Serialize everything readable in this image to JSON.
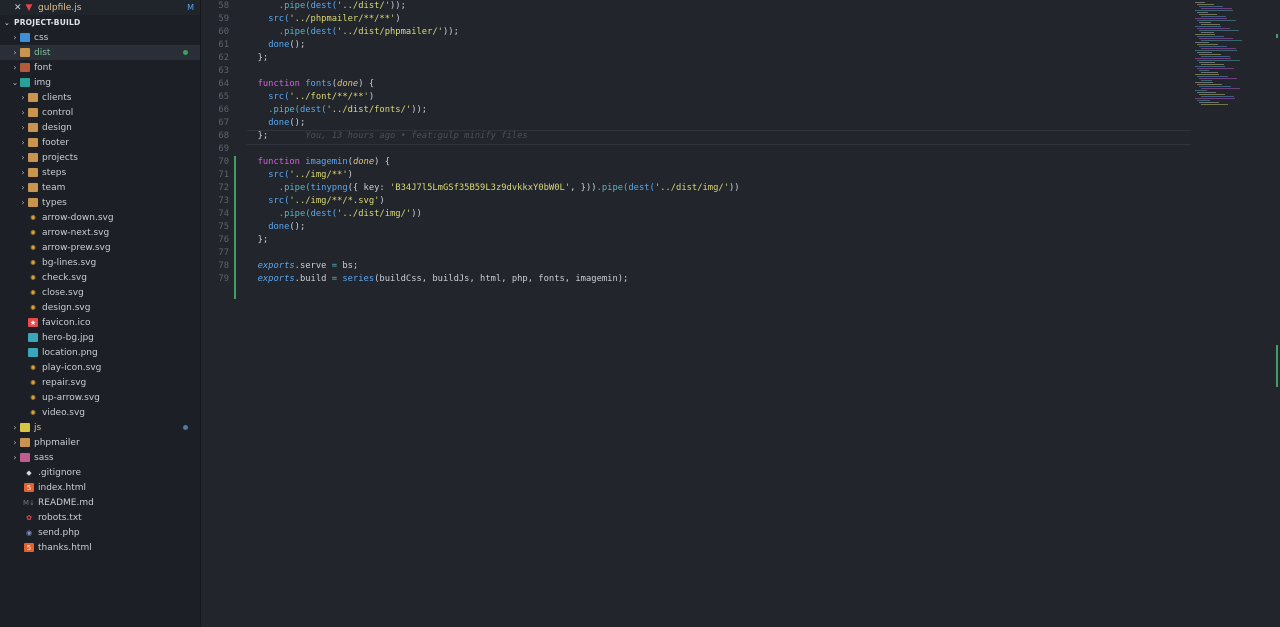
{
  "open_editor": {
    "close": "✕",
    "file": "gulpfile.js",
    "badge": "M"
  },
  "explorer": {
    "title": "PROJECT-BUILD",
    "items": [
      {
        "label": "css",
        "depth": 0,
        "type": "folder",
        "icon": "css-folder-icon",
        "open": false
      },
      {
        "label": "dist",
        "depth": 0,
        "type": "folder",
        "icon": "dist-folder-icon",
        "open": false,
        "selected": true,
        "dot": "#3f9e62"
      },
      {
        "label": "font",
        "depth": 0,
        "type": "folder",
        "icon": "font-folder-icon",
        "open": false
      },
      {
        "label": "img",
        "depth": 0,
        "type": "folder",
        "icon": "img-folder-icon",
        "open": true
      },
      {
        "label": "clients",
        "depth": 1,
        "type": "folder",
        "icon": "folder-icon",
        "open": false
      },
      {
        "label": "control",
        "depth": 1,
        "type": "folder",
        "icon": "folder-icon",
        "open": false
      },
      {
        "label": "design",
        "depth": 1,
        "type": "folder",
        "icon": "folder-icon",
        "open": false
      },
      {
        "label": "footer",
        "depth": 1,
        "type": "folder",
        "icon": "folder-icon",
        "open": false
      },
      {
        "label": "projects",
        "depth": 1,
        "type": "folder",
        "icon": "folder-icon",
        "open": false
      },
      {
        "label": "steps",
        "depth": 1,
        "type": "folder",
        "icon": "folder-icon",
        "open": false
      },
      {
        "label": "team",
        "depth": 1,
        "type": "folder",
        "icon": "folder-icon",
        "open": false
      },
      {
        "label": "types",
        "depth": 1,
        "type": "folder",
        "icon": "folder-icon",
        "open": false
      },
      {
        "label": "arrow-down.svg",
        "depth": 1,
        "type": "file",
        "icon": "svg-file-icon"
      },
      {
        "label": "arrow-next.svg",
        "depth": 1,
        "type": "file",
        "icon": "svg-file-icon"
      },
      {
        "label": "arrow-prew.svg",
        "depth": 1,
        "type": "file",
        "icon": "svg-file-icon"
      },
      {
        "label": "bg-lines.svg",
        "depth": 1,
        "type": "file",
        "icon": "svg-file-icon"
      },
      {
        "label": "check.svg",
        "depth": 1,
        "type": "file",
        "icon": "svg-file-icon"
      },
      {
        "label": "close.svg",
        "depth": 1,
        "type": "file",
        "icon": "svg-file-icon"
      },
      {
        "label": "design.svg",
        "depth": 1,
        "type": "file",
        "icon": "svg-file-icon"
      },
      {
        "label": "favicon.ico",
        "depth": 1,
        "type": "file",
        "icon": "favicon-file-icon"
      },
      {
        "label": "hero-bg.jpg",
        "depth": 1,
        "type": "file",
        "icon": "image-file-icon"
      },
      {
        "label": "location.png",
        "depth": 1,
        "type": "file",
        "icon": "image-file-icon"
      },
      {
        "label": "play-icon.svg",
        "depth": 1,
        "type": "file",
        "icon": "svg-file-icon"
      },
      {
        "label": "repair.svg",
        "depth": 1,
        "type": "file",
        "icon": "svg-file-icon"
      },
      {
        "label": "up-arrow.svg",
        "depth": 1,
        "type": "file",
        "icon": "svg-file-icon"
      },
      {
        "label": "video.svg",
        "depth": 1,
        "type": "file",
        "icon": "svg-file-icon"
      },
      {
        "label": "js",
        "depth": 0,
        "type": "folder",
        "icon": "js-folder-icon",
        "open": false,
        "dot": "#4d7a9e"
      },
      {
        "label": "phpmailer",
        "depth": 0,
        "type": "folder",
        "icon": "php-folder-icon",
        "open": false
      },
      {
        "label": "sass",
        "depth": 0,
        "type": "folder",
        "icon": "sass-folder-icon",
        "open": false
      },
      {
        "label": ".gitignore",
        "depth": 0,
        "type": "file",
        "icon": "git-file-icon"
      },
      {
        "label": "index.html",
        "depth": 0,
        "type": "file",
        "icon": "html-file-icon"
      },
      {
        "label": "README.md",
        "depth": 0,
        "type": "file",
        "icon": "markdown-file-icon"
      },
      {
        "label": "robots.txt",
        "depth": 0,
        "type": "file",
        "icon": "robot-file-icon"
      },
      {
        "label": "send.php",
        "depth": 0,
        "type": "file",
        "icon": "php-file-icon"
      },
      {
        "label": "thanks.html",
        "depth": 0,
        "type": "file",
        "icon": "html-file-icon"
      }
    ]
  },
  "code": {
    "lines": [
      {
        "n": "58",
        "t": [
          [
            "pl",
            "      "
          ],
          [
            "met",
            ".pipe("
          ],
          [
            "fn",
            "dest("
          ],
          [
            "str",
            "'../dist/'"
          ],
          [
            "pl",
            "));"
          ]
        ]
      },
      {
        "n": "59",
        "t": [
          [
            "pl",
            "    "
          ],
          [
            "fn",
            "src("
          ],
          [
            "str",
            "'../phpmailer/**/**'"
          ],
          [
            "pl",
            ")"
          ]
        ]
      },
      {
        "n": "60",
        "t": [
          [
            "pl",
            "      "
          ],
          [
            "met",
            ".pipe("
          ],
          [
            "fn",
            "dest("
          ],
          [
            "str",
            "'../dist/phpmailer/'"
          ],
          [
            "pl",
            "));"
          ]
        ]
      },
      {
        "n": "61",
        "t": [
          [
            "pl",
            "    "
          ],
          [
            "fn",
            "done"
          ],
          [
            "pl",
            "();"
          ]
        ]
      },
      {
        "n": "62",
        "t": [
          [
            "pl",
            "  };"
          ]
        ]
      },
      {
        "n": "63",
        "t": [
          [
            "pl",
            ""
          ]
        ]
      },
      {
        "n": "64",
        "t": [
          [
            "pl",
            "  "
          ],
          [
            "kw",
            "function "
          ],
          [
            "fn",
            "fonts"
          ],
          [
            "pl",
            "("
          ],
          [
            "pr",
            "done"
          ],
          [
            "pl",
            ") {"
          ]
        ]
      },
      {
        "n": "65",
        "t": [
          [
            "pl",
            "    "
          ],
          [
            "fn",
            "src("
          ],
          [
            "str",
            "'../font/**/**'"
          ],
          [
            "pl",
            ")"
          ]
        ]
      },
      {
        "n": "66",
        "t": [
          [
            "pl",
            "    "
          ],
          [
            "met",
            ".pipe("
          ],
          [
            "fn",
            "dest("
          ],
          [
            "str",
            "'../dist/fonts/'"
          ],
          [
            "pl",
            "));"
          ]
        ]
      },
      {
        "n": "67",
        "t": [
          [
            "pl",
            "    "
          ],
          [
            "fn",
            "done"
          ],
          [
            "pl",
            "();"
          ]
        ]
      },
      {
        "n": "68",
        "t": [
          [
            "pl",
            "  };"
          ],
          [
            "blame",
            "       You, 13 hours ago • feat:gulp minify files"
          ]
        ]
      },
      {
        "n": "69",
        "t": [
          [
            "pl",
            ""
          ]
        ]
      },
      {
        "n": "70",
        "t": [
          [
            "pl",
            "  "
          ],
          [
            "kw",
            "function "
          ],
          [
            "fn",
            "imagemin"
          ],
          [
            "pl",
            "("
          ],
          [
            "pr",
            "done"
          ],
          [
            "pl",
            ") {"
          ]
        ]
      },
      {
        "n": "71",
        "t": [
          [
            "pl",
            "    "
          ],
          [
            "fn",
            "src("
          ],
          [
            "str",
            "'../img/**'"
          ],
          [
            "pl",
            ")"
          ]
        ]
      },
      {
        "n": "72",
        "t": [
          [
            "pl",
            "      "
          ],
          [
            "met",
            ".pipe("
          ],
          [
            "fn",
            "tinypng"
          ],
          [
            "pl",
            "({ key: "
          ],
          [
            "str",
            "'B34J7l5LmGSf35B59L3z9dvkkxY0bW0L'"
          ],
          [
            "pl",
            ", }))"
          ],
          [
            "met",
            ".pipe("
          ],
          [
            "fn",
            "dest("
          ],
          [
            "str",
            "'../dist/img/'"
          ],
          [
            "pl",
            "))"
          ]
        ]
      },
      {
        "n": "73",
        "t": [
          [
            "pl",
            "    "
          ],
          [
            "fn",
            "src("
          ],
          [
            "str",
            "'../img/**/*.svg'"
          ],
          [
            "pl",
            ")"
          ]
        ]
      },
      {
        "n": "74",
        "t": [
          [
            "pl",
            "      "
          ],
          [
            "met",
            ".pipe("
          ],
          [
            "fn",
            "dest("
          ],
          [
            "str",
            "'../dist/img/'"
          ],
          [
            "pl",
            "))"
          ]
        ]
      },
      {
        "n": "75",
        "t": [
          [
            "pl",
            "    "
          ],
          [
            "fn",
            "done"
          ],
          [
            "pl",
            "();"
          ]
        ]
      },
      {
        "n": "76",
        "t": [
          [
            "pl",
            "  };"
          ]
        ]
      },
      {
        "n": "77",
        "t": [
          [
            "pl",
            ""
          ]
        ]
      },
      {
        "n": "78",
        "t": [
          [
            "pl",
            "  "
          ],
          [
            "exp",
            "exports"
          ],
          [
            "pl",
            ".serve "
          ],
          [
            "op",
            "="
          ],
          [
            "pl",
            " bs;"
          ]
        ]
      },
      {
        "n": "79",
        "t": [
          [
            "pl",
            "  "
          ],
          [
            "exp",
            "exports"
          ],
          [
            "pl",
            ".build "
          ],
          [
            "op",
            "="
          ],
          [
            "pl",
            " "
          ],
          [
            "fn",
            "series"
          ],
          [
            "pl",
            "(buildCss, buildJs, html, php, fonts, imagemin);"
          ]
        ]
      }
    ]
  },
  "colors": {
    "git_added": "#3f9e62",
    "accent": "#5aa8f0"
  }
}
